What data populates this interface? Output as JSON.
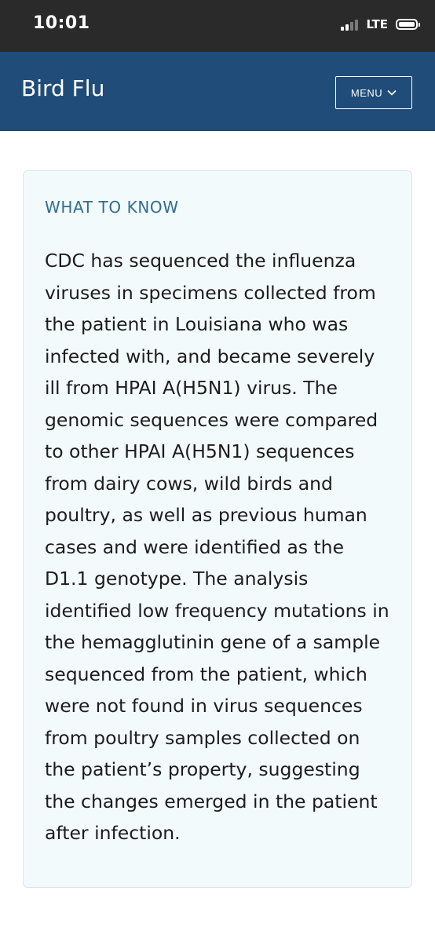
{
  "status_bar": {
    "time": "10:01",
    "network": "LTE"
  },
  "header": {
    "title": "Bird Flu",
    "menu_label": "MENU",
    "background_color": "#1f4c78"
  },
  "card": {
    "heading": "WHAT TO KNOW",
    "body": "CDC has sequenced the influenza viruses in specimens collected from the patient in Louisiana who was infected with, and became severely ill from HPAI A(H5N1) virus. The genomic sequences were compared to other HPAI A(H5N1) sequences from dairy cows, wild birds and poultry, as well as previous human cases and were identified as the D1.1 genotype. The analysis identified low frequency mutations in the hemagglutinin gene of a sample sequenced from the patient, which were not found in virus sequences from poultry samples collected on the patient’s property, suggesting the changes emerged in the patient after infection.",
    "background_color": "#f3fafb",
    "heading_color": "#2f6e8e"
  },
  "icons": {
    "signal": "signal-bars-icon",
    "battery": "battery-icon",
    "menu_chevron": "chevron-down-icon"
  }
}
